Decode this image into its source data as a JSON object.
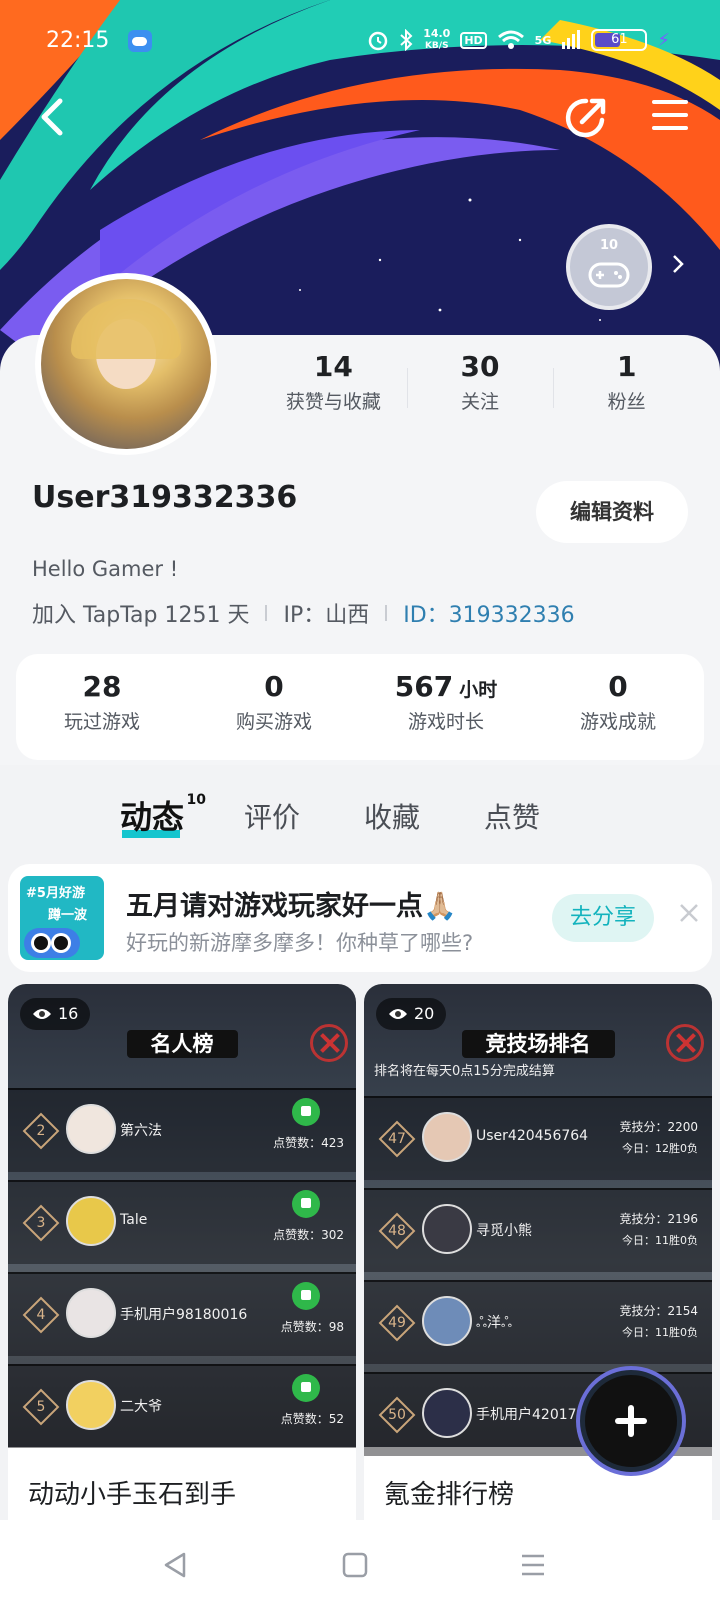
{
  "status_bar": {
    "time": "22:15",
    "speed_top": "14.0",
    "speed_unit": "KB/S",
    "hd": "HD",
    "network": "5G",
    "battery": "61"
  },
  "profile": {
    "badge_number": "10",
    "stats_top": [
      {
        "value": "14",
        "label": "获赞与收藏"
      },
      {
        "value": "30",
        "label": "关注"
      },
      {
        "value": "1",
        "label": "粉丝"
      }
    ],
    "username": "User319332336",
    "edit_label": "编辑资料",
    "bio": "Hello Gamer !",
    "joined": "加入 TapTap 1251 天",
    "ip": "IP：山西",
    "id": "ID：319332336"
  },
  "game_stats": [
    {
      "value": "28",
      "unit": "",
      "label": "玩过游戏"
    },
    {
      "value": "0",
      "unit": "",
      "label": "购买游戏"
    },
    {
      "value": "567",
      "unit": "小时",
      "label": "游戏时长"
    },
    {
      "value": "0",
      "unit": "",
      "label": "游戏成就"
    }
  ],
  "tabs": [
    {
      "label": "动态",
      "count": "10"
    },
    {
      "label": "评价"
    },
    {
      "label": "收藏"
    },
    {
      "label": "点赞"
    }
  ],
  "promo": {
    "thumb_line1": "#5月好游",
    "thumb_line2": "蹲一波",
    "title": "五月请对游戏玩家好一点🙏🏼",
    "subtitle": "好玩的新游摩多摩多！你种草了哪些?",
    "button": "去分享"
  },
  "posts": [
    {
      "views": "16",
      "shot_title": "名人榜",
      "rows": [
        {
          "rank": "2",
          "name": "第六法",
          "likes": "点赞数：423"
        },
        {
          "rank": "3",
          "name": "Tale",
          "likes": "点赞数：302"
        },
        {
          "rank": "4",
          "name": "手机用户98180016",
          "likes": "点赞数：98"
        },
        {
          "rank": "5",
          "name": "二大爷",
          "likes": "点赞数：52"
        }
      ],
      "caption": "动动小手玉石到手"
    },
    {
      "views": "20",
      "shot_title": "竞技场排名",
      "note": "排名将在每天0点15分完成结算",
      "rows": [
        {
          "rank": "47",
          "name": "User420456764",
          "score": "竞技分：2200",
          "today": "今日：12胜0负"
        },
        {
          "rank": "48",
          "name": "寻觅小熊",
          "score": "竞技分：2196",
          "today": "今日：11胜0负"
        },
        {
          "rank": "49",
          "name": "ஃ洋ஃ",
          "score": "竞技分：2154",
          "today": "今日：11胜0负"
        },
        {
          "rank": "50",
          "name": "手机用户420176",
          "score": "",
          "today": ""
        }
      ],
      "caption": "氪金排行榜"
    }
  ]
}
